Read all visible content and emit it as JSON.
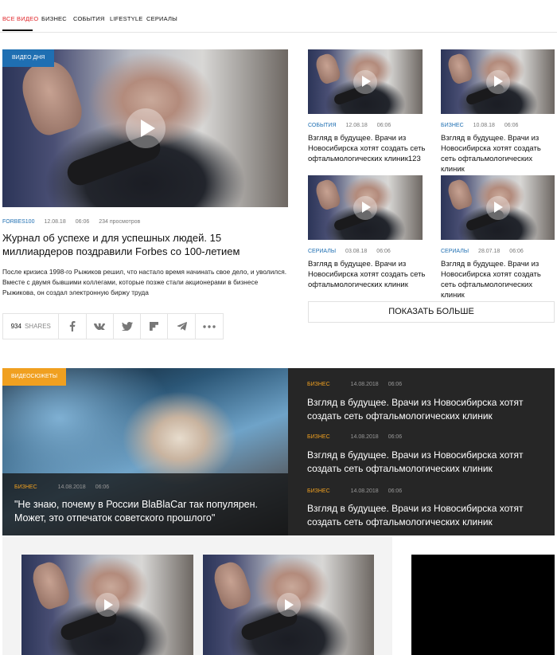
{
  "nav": {
    "items": [
      "ВСЕ ВИДЕО",
      "БИЗНЕС",
      "СОБЫТИЯ",
      "LIFESTYLE",
      "СЕРИАЛЫ"
    ]
  },
  "featured": {
    "badge": "ВИДЕО ДНЯ",
    "tag": "FORBES100",
    "date": "12.08.18",
    "time": "06:06",
    "views": "234 просмотров",
    "title": "Журнал об успехе и для успешных людей. 15 миллиардеров поздравили Forbes со 100-летием",
    "lead": "После кризиса 1998-го Рыжиков решил, что настало время начинать свое дело, и уволился. Вместе с двумя бывшими коллегами, которые позже стали акционерами в бизнесе Рыжикова, он создал электронную биржу труда",
    "shares_count": "934",
    "shares_label": "SHARES"
  },
  "share_icons": [
    "facebook-icon",
    "vk-icon",
    "twitter-icon",
    "flipboard-icon",
    "telegram-icon",
    "more-dots-icon"
  ],
  "cards": [
    {
      "tag": "СОБЫТИЯ",
      "date": "12.08.18",
      "time": "06:06",
      "title": "Взгляд в будущее. Врачи из Новосибирска хотят создать сеть офтальмологических клиник123"
    },
    {
      "tag": "БИЗНЕС",
      "date": "10.08.18",
      "time": "06:06",
      "title": "Взгляд в будущее. Врачи из Новосибирска хотят создать сеть офтальмологических клиник"
    },
    {
      "tag": "СЕРИАЛЫ",
      "date": "03.08.18",
      "time": "06:06",
      "title": "Взгляд в будущее. Врачи из Новосибирска хотят создать сеть офтальмологических клиник"
    },
    {
      "tag": "СЕРИАЛЫ",
      "date": "28.07.18",
      "time": "06:06",
      "title": "Взгляд в будущее. Врачи из Новосибирска хотят создать сеть офтальмологических клиник"
    }
  ],
  "more_button": "ПОКАЗАТЬ БОЛЬШЕ",
  "video_stories": {
    "badge": "ВИДЕОСЮЖЕТЫ",
    "main": {
      "tag": "БИЗНЕС",
      "date": "14.08.2018",
      "time": "06:06",
      "title": "\"Не знаю, почему в России BlaBlaCar так популярен. Может, это отпечаток советского прошлого\""
    },
    "list": [
      {
        "tag": "БИЗНЕС",
        "date": "14.08.2018",
        "time": "06:06",
        "title": "Взгляд в будущее. Врачи из Новосибирска хотят создать сеть офтальмологических клиник"
      },
      {
        "tag": "БИЗНЕС",
        "date": "14.08.2018",
        "time": "06:06",
        "title": "Взгляд в будущее. Врачи из Новосибирска хотят создать сеть офтальмологических клиник"
      },
      {
        "tag": "БИЗНЕС",
        "date": "14.08.2018",
        "time": "06:06",
        "title": "Взгляд в будущее. Врачи из Новосибирска хотят создать сеть офтальмологических клиник"
      }
    ]
  },
  "colors": {
    "accent_red": "#e0282c",
    "tag_blue": "#1f6fb2",
    "tag_orange": "#f0a020",
    "dark_bg": "#262626"
  }
}
